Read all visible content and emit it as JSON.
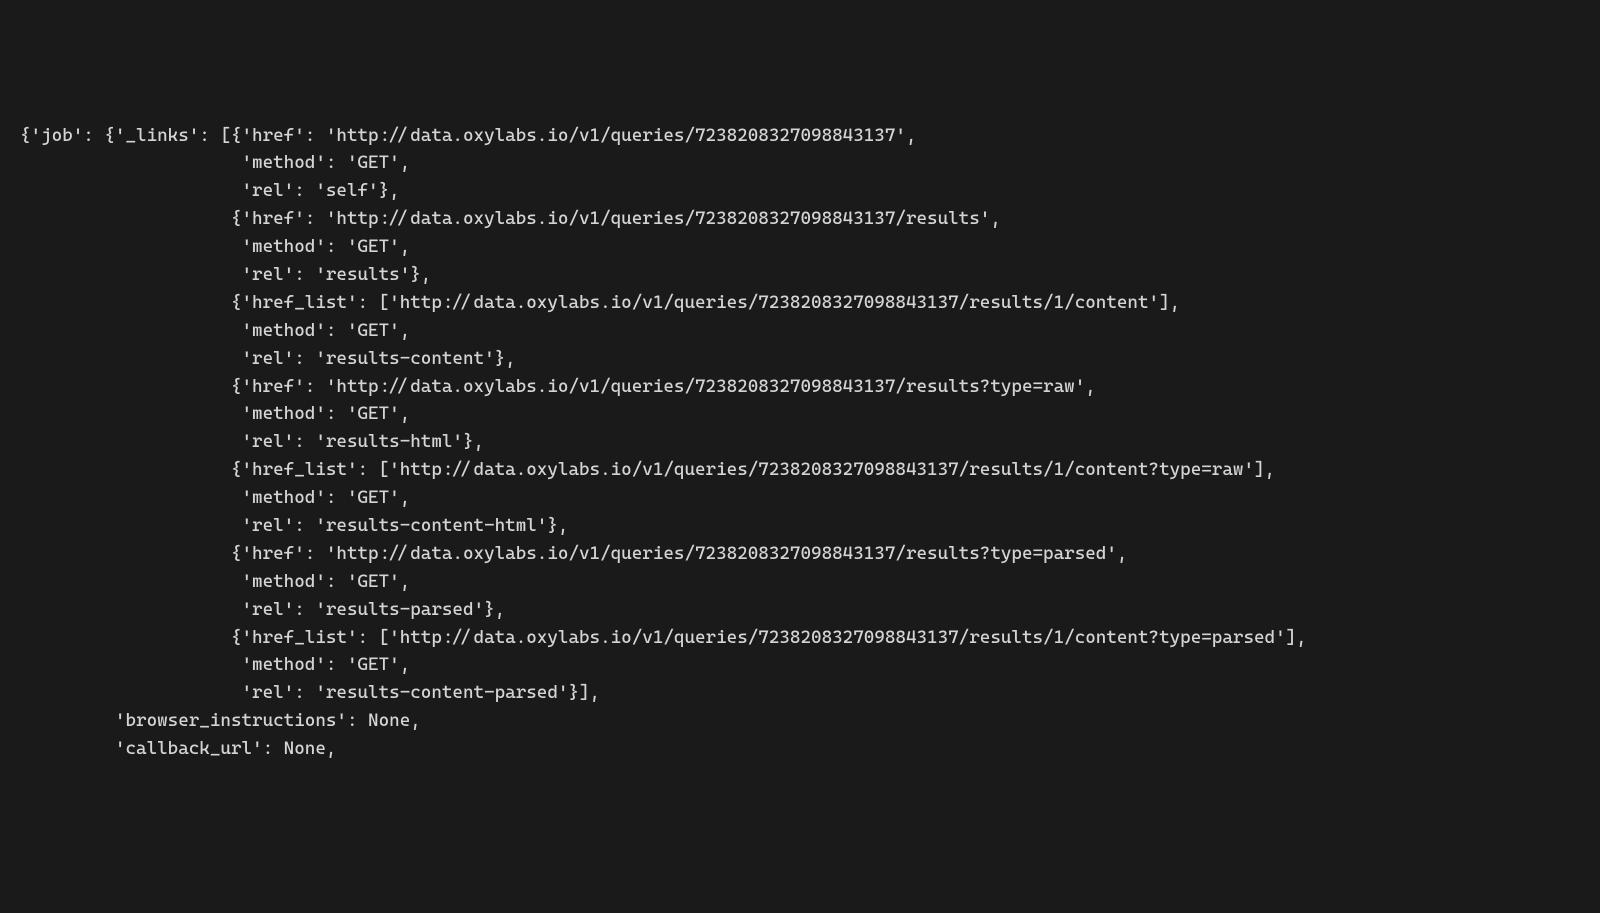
{
  "code": {
    "lines": [
      "{'job': {'_links': [{'href': 'http://data.oxylabs.io/v1/queries/7238208327098843137',",
      "                     'method': 'GET',",
      "                     'rel': 'self'},",
      "                    {'href': 'http://data.oxylabs.io/v1/queries/7238208327098843137/results',",
      "                     'method': 'GET',",
      "                     'rel': 'results'},",
      "                    {'href_list': ['http://data.oxylabs.io/v1/queries/7238208327098843137/results/1/content'],",
      "                     'method': 'GET',",
      "                     'rel': 'results-content'},",
      "                    {'href': 'http://data.oxylabs.io/v1/queries/7238208327098843137/results?type=raw',",
      "                     'method': 'GET',",
      "                     'rel': 'results-html'},",
      "                    {'href_list': ['http://data.oxylabs.io/v1/queries/7238208327098843137/results/1/content?type=raw'],",
      "                     'method': 'GET',",
      "                     'rel': 'results-content-html'},",
      "                    {'href': 'http://data.oxylabs.io/v1/queries/7238208327098843137/results?type=parsed',",
      "                     'method': 'GET',",
      "                     'rel': 'results-parsed'},",
      "                    {'href_list': ['http://data.oxylabs.io/v1/queries/7238208327098843137/results/1/content?type=parsed'],",
      "                     'method': 'GET',",
      "                     'rel': 'results-content-parsed'}],",
      "         'browser_instructions': None,",
      "         'callback_url': None,"
    ]
  }
}
